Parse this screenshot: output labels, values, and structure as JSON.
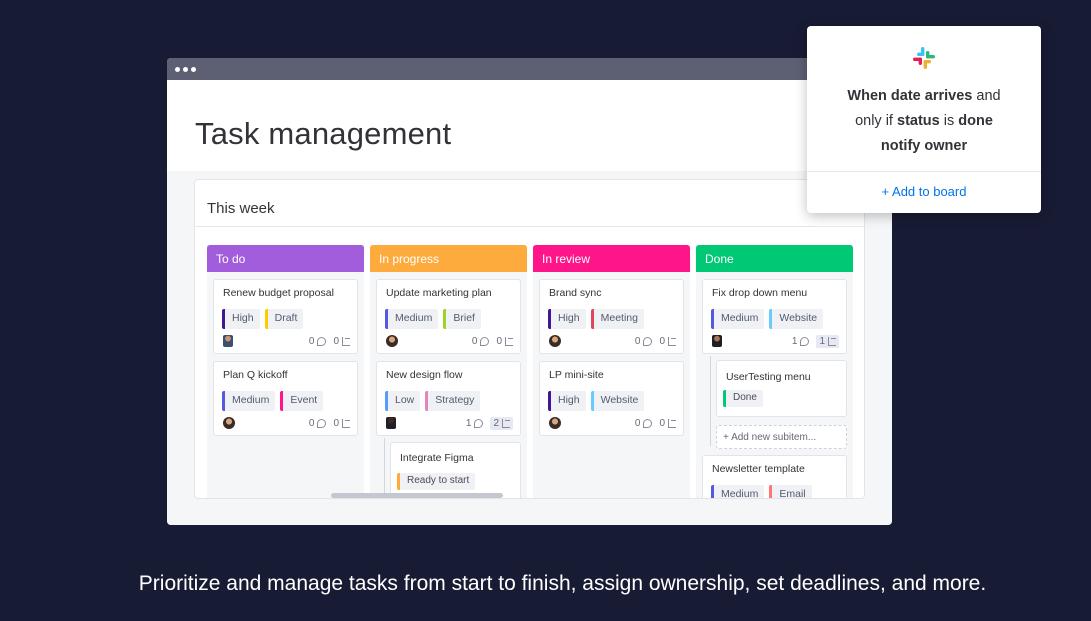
{
  "app": {
    "window_title": "Task management"
  },
  "board": {
    "title": "This week"
  },
  "columns": [
    {
      "label": "To do",
      "color": "#a25ddc"
    },
    {
      "label": "In progress",
      "color": "#fdab3d"
    },
    {
      "label": "In review",
      "color": "#ff158a"
    },
    {
      "label": "Done",
      "color": "#00c875"
    }
  ],
  "cards": {
    "todo_1": {
      "title": "Renew budget proposal",
      "tag1": "High",
      "tag2": "Draft",
      "comments": "0",
      "subitems": "0"
    },
    "todo_2": {
      "title": "Plan Q kickoff",
      "tag1": "Medium",
      "tag2": "Event",
      "comments": "0",
      "subitems": "0"
    },
    "progress_1": {
      "title": "Update marketing plan",
      "tag1": "Medium",
      "tag2": "Brief",
      "comments": "0",
      "subitems": "0"
    },
    "progress_2": {
      "title": "New design flow",
      "tag1": "Low",
      "tag2": "Strategy",
      "comments": "1",
      "subitems": "2"
    },
    "progress_sub": {
      "title": "Integrate Figma",
      "status": "Ready to start"
    },
    "review_1": {
      "title": "Brand sync",
      "tag1": "High",
      "tag2": "Meeting",
      "comments": "0",
      "subitems": "0"
    },
    "review_2": {
      "title": "LP mini-site",
      "tag1": "High",
      "tag2": "Website",
      "comments": "0",
      "subitems": "0"
    },
    "done_1": {
      "title": "Fix drop down menu",
      "tag1": "Medium",
      "tag2": "Website",
      "comments": "1",
      "subitems": "1"
    },
    "done_sub": {
      "title": "UserTesting menu",
      "status": "Done",
      "add_label": "+ Add new subitem..."
    },
    "done_2": {
      "title": "Newsletter template",
      "tag1": "Medium",
      "tag2": "Email"
    }
  },
  "tag_colors": {
    "High": "#401694",
    "Medium": "#5559df",
    "Low": "#579bfc",
    "Draft": "#ffcb00",
    "Event": "#ff158a",
    "Brief": "#9cd326",
    "Strategy": "#e484bd",
    "Meeting": "#e2445c",
    "Website": "#66ccff",
    "Email": "#ff7575",
    "Ready to start": "#fdab3d",
    "Done": "#00c875"
  },
  "automation": {
    "line1_bold": "When date arrives",
    "line1_rest": "and",
    "line2_pre": "only if",
    "line2_bold1": "status",
    "line2_mid": "is",
    "line2_bold2": "done",
    "line3_bold": "notify owner",
    "add_button": "+ Add to board"
  },
  "caption": "Prioritize and manage tasks from start to finish, assign ownership, set deadlines, and more."
}
